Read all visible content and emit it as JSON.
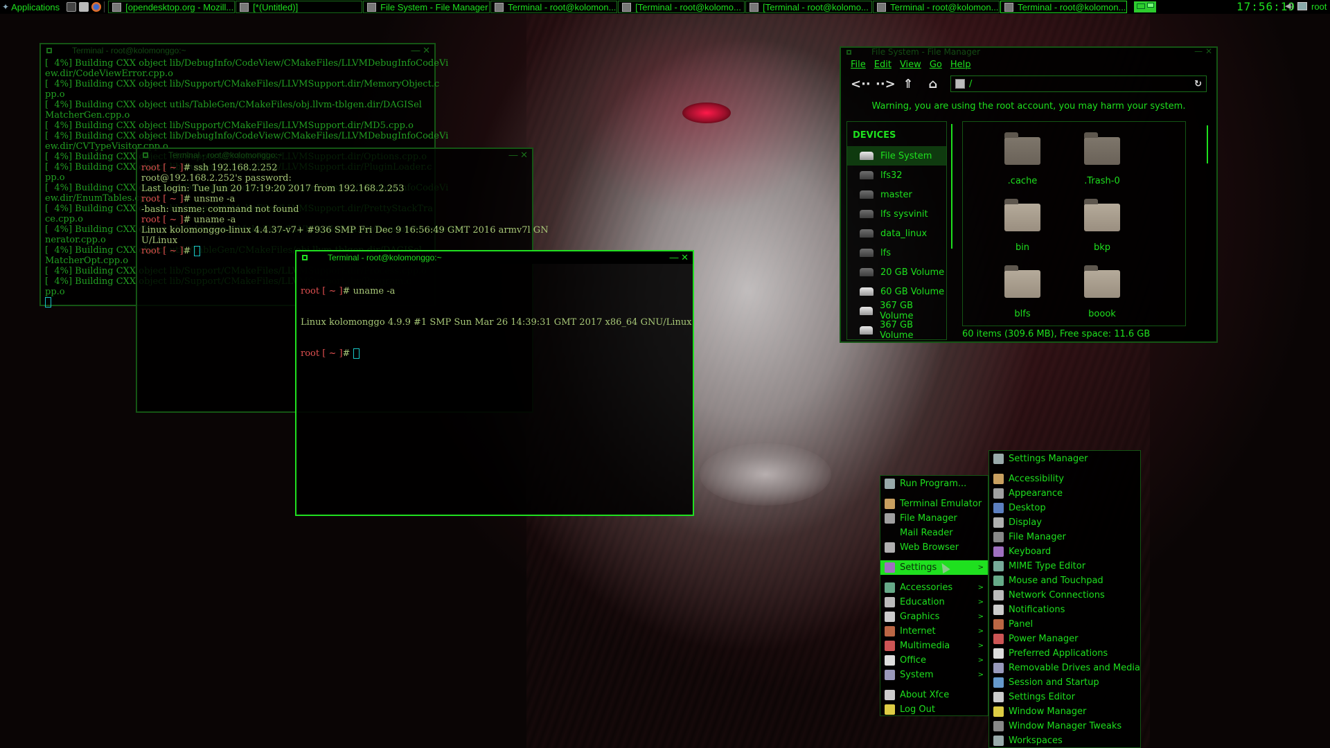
{
  "panel": {
    "applications_label": "Applications",
    "launchers": [
      "terminal-icon",
      "file-manager-icon",
      "firefox-icon"
    ],
    "tasks": [
      {
        "icon": "firefox-icon",
        "label": "[opendesktop.org - Mozill..."
      },
      {
        "icon": "editor-icon",
        "label": "[*(Untitled)]"
      },
      {
        "icon": "file-manager-icon",
        "label": "File System - File Manager"
      },
      {
        "icon": "terminal-icon",
        "label": "Terminal - root@kolomon..."
      },
      {
        "icon": "terminal-icon",
        "label": "[Terminal - root@kolomo..."
      },
      {
        "icon": "terminal-icon",
        "label": "[Terminal - root@kolomo..."
      },
      {
        "icon": "terminal-icon",
        "label": "Terminal - root@kolomon..."
      },
      {
        "icon": "terminal-icon",
        "label": "Terminal - root@kolomon...",
        "active": true
      }
    ],
    "clock": "17:56:19",
    "user": "root"
  },
  "terminals": {
    "back": {
      "title": "Terminal - root@kolomonggo:~",
      "lines": [
        "[  4%] Building CXX object lib/DebugInfo/CodeView/CMakeFiles/LLVMDebugInfoCodeVi",
        "ew.dir/CodeViewError.cpp.o",
        "[  4%] Building CXX object lib/Support/CMakeFiles/LLVMSupport.dir/MemoryObject.c",
        "pp.o",
        "[  4%] Building CXX object utils/TableGen/CMakeFiles/obj.llvm-tblgen.dir/DAGISel",
        "MatcherGen.cpp.o",
        "[  4%] Building CXX object lib/Support/CMakeFiles/LLVMSupport.dir/MD5.cpp.o",
        "[  4%] Building CXX object lib/DebugInfo/CodeView/CMakeFiles/LLVMDebugInfoCodeVi",
        "ew.dir/CVTypeVisitor.cpp.o",
        "[  4%] Building CXX object lib/Support/CMakeFiles/LLVMSupport.dir/Options.cpp.o",
        "[  4%] Building CXX object lib/Support/CMakeFiles/LLVMSupport.dir/PluginLoader.c",
        "pp.o",
        "[  4%] Building CXX object lib/DebugInfo/CodeView/CMakeFiles/LLVMDebugInfoCodeVi",
        "ew.dir/EnumTables.cpp.o",
        "[  4%] Building CXX object lib/Support/CMakeFiles/LLVMSupport.dir/PrettyStackTra",
        "ce.cpp.o",
        "[  4%] Building CXX object lib/TableGen/CMakeFiles/LLVMTableGen.dir/RandomNumberGe",
        "nerator.cpp.o",
        "[  4%] Building CXX object utils/TableGen/CMakeFiles/obj.llvm-tblgen.dir/DAGISel",
        "MatcherOpt.cpp.o",
        "[  4%] Building CXX object lib/Support/CMakeFiles/LLVMSupport.dir/Process.cpp.o",
        "[  4%] Building CXX object lib/Support/CMakeFiles/LLVMSupport.dir/Program.c",
        "pp.o"
      ]
    },
    "middle": {
      "title": "Terminal - root@kolomonggo:~",
      "prompt_user": "root",
      "prompt_path": "[ ~ ]#",
      "lines": [
        {
          "type": "cmd",
          "text": " ssh 192.168.2.252"
        },
        {
          "type": "out",
          "text": "root@192.168.2.252's password:"
        },
        {
          "type": "out",
          "text": "Last login: Tue Jun 20 17:19:20 2017 from 192.168.2.253"
        },
        {
          "type": "cmd",
          "text": " unsme -a"
        },
        {
          "type": "out",
          "text": "-bash: unsme: command not found"
        },
        {
          "type": "cmd",
          "text": " uname -a"
        },
        {
          "type": "out",
          "text": "Linux kolomonggo-linux 4.4.37-v7+ #936 SMP Fri Dec 9 16:56:49 GMT 2016 armv7l GN"
        },
        {
          "type": "out",
          "text": "U/Linux"
        }
      ]
    },
    "front": {
      "title": "Terminal - root@kolomonggo:~",
      "prompt_user": "root",
      "prompt_path": "[ ~ ]#",
      "command": " uname -a",
      "output": "Linux kolomonggo 4.9.9 #1 SMP Sun Mar 26 14:39:31 GMT 2017 x86_64 GNU/Linux"
    }
  },
  "file_manager": {
    "title": "File System - File Manager",
    "menu": [
      "File",
      "Edit",
      "View",
      "Go",
      "Help"
    ],
    "location": "/",
    "warning": "Warning, you are using the root account, you may harm your system.",
    "devices_header": "DEVICES",
    "devices": [
      {
        "label": "File System",
        "selected": true,
        "mounted": true
      },
      {
        "label": "lfs32",
        "mounted": false
      },
      {
        "label": "master",
        "mounted": false
      },
      {
        "label": "lfs sysvinit",
        "mounted": false
      },
      {
        "label": "data_linux",
        "mounted": false
      },
      {
        "label": "lfs",
        "mounted": false
      },
      {
        "label": "20 GB Volume",
        "mounted": false
      },
      {
        "label": "60 GB Volume",
        "mounted": true
      },
      {
        "label": "367 GB Volume",
        "mounted": true
      },
      {
        "label": "367 GB Volume",
        "mounted": true
      }
    ],
    "folders": [
      ".cache",
      ".Trash-0",
      "bin",
      "bkp",
      "blfs",
      "boook"
    ],
    "status": "60 items (309.6 MB), Free space: 11.6 GB"
  },
  "app_menu": {
    "items": [
      {
        "label": "Run Program...",
        "icon": "run-program-icon"
      },
      {
        "sep": true
      },
      {
        "label": "Terminal Emulator",
        "icon": "terminal-icon"
      },
      {
        "label": "File Manager",
        "icon": "file-manager-icon"
      },
      {
        "label": "Mail Reader",
        "icon": ""
      },
      {
        "label": "Web Browser",
        "icon": "web-browser-icon"
      },
      {
        "sep": true
      },
      {
        "label": "Settings",
        "icon": "settings-icon",
        "submenu": true,
        "highlighted": true
      },
      {
        "sep": true
      },
      {
        "label": "Accessories",
        "icon": "accessories-icon",
        "submenu": true
      },
      {
        "label": "Education",
        "icon": "education-icon",
        "submenu": true
      },
      {
        "label": "Graphics",
        "icon": "graphics-icon",
        "submenu": true
      },
      {
        "label": "Internet",
        "icon": "internet-icon",
        "submenu": true
      },
      {
        "label": "Multimedia",
        "icon": "multimedia-icon",
        "submenu": true
      },
      {
        "label": "Office",
        "icon": "office-icon",
        "submenu": true
      },
      {
        "label": "System",
        "icon": "system-icon",
        "submenu": true
      },
      {
        "sep": true
      },
      {
        "label": "About Xfce",
        "icon": "about-icon"
      },
      {
        "label": "Log Out",
        "icon": "logout-icon"
      }
    ]
  },
  "settings_menu": {
    "items": [
      {
        "label": "Settings Manager",
        "icon": "settings-manager-icon"
      },
      {
        "sep": true
      },
      {
        "label": "Accessibility",
        "icon": "accessibility-icon"
      },
      {
        "label": "Appearance",
        "icon": "appearance-icon"
      },
      {
        "label": "Desktop",
        "icon": "desktop-icon"
      },
      {
        "label": "Display",
        "icon": "display-icon"
      },
      {
        "label": "File Manager",
        "icon": "file-manager-icon"
      },
      {
        "label": "Keyboard",
        "icon": "keyboard-icon"
      },
      {
        "label": "MIME Type Editor",
        "icon": "mime-icon"
      },
      {
        "label": "Mouse and Touchpad",
        "icon": "mouse-icon"
      },
      {
        "label": "Network Connections",
        "icon": "network-icon"
      },
      {
        "label": "Notifications",
        "icon": "notifications-icon"
      },
      {
        "label": "Panel",
        "icon": "panel-icon"
      },
      {
        "label": "Power Manager",
        "icon": "power-icon"
      },
      {
        "label": "Preferred Applications",
        "icon": "preferred-apps-icon"
      },
      {
        "label": "Removable Drives and Media",
        "icon": "removable-drives-icon"
      },
      {
        "label": "Session and Startup",
        "icon": "session-icon"
      },
      {
        "label": "Settings Editor",
        "icon": "settings-editor-icon"
      },
      {
        "label": "Window Manager",
        "icon": "window-manager-icon"
      },
      {
        "label": "Window Manager Tweaks",
        "icon": "wm-tweaks-icon"
      },
      {
        "label": "Workspaces",
        "icon": "workspaces-icon"
      }
    ]
  },
  "colors": {
    "accent": "#1ee01e",
    "prompt": "#e05050",
    "cursor": "#18c8c8"
  }
}
